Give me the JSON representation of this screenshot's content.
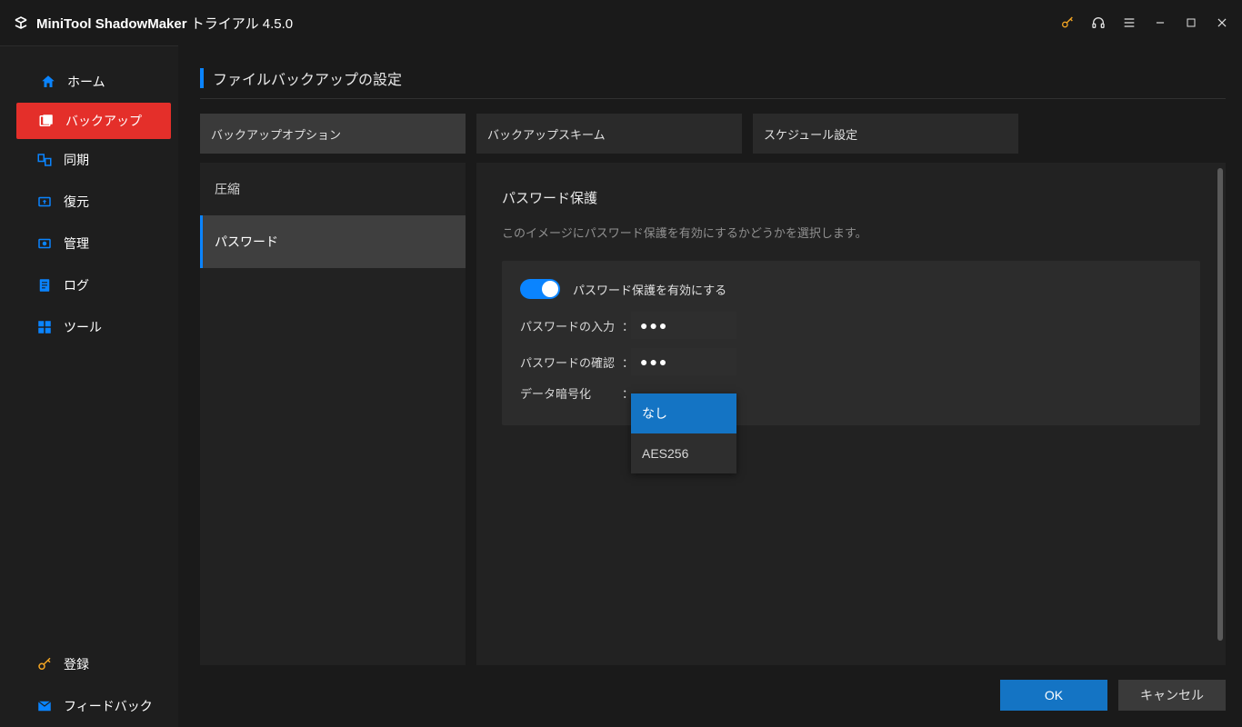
{
  "titlebar": {
    "app_name": "MiniTool ShadowMaker",
    "edition": "トライアル 4.5.0"
  },
  "sidebar": {
    "items": [
      {
        "label": "ホーム",
        "icon": "home"
      },
      {
        "label": "バックアップ",
        "icon": "backup"
      },
      {
        "label": "同期",
        "icon": "sync"
      },
      {
        "label": "復元",
        "icon": "restore"
      },
      {
        "label": "管理",
        "icon": "manage"
      },
      {
        "label": "ログ",
        "icon": "log"
      },
      {
        "label": "ツール",
        "icon": "tools"
      }
    ],
    "bottom": [
      {
        "label": "登録",
        "icon": "key"
      },
      {
        "label": "フィードバック",
        "icon": "feedback"
      }
    ]
  },
  "page": {
    "title": "ファイルバックアップの設定",
    "tabs": [
      {
        "label": "バックアップオプション"
      },
      {
        "label": "バックアップスキーム"
      },
      {
        "label": "スケジュール設定"
      }
    ],
    "options": [
      {
        "label": "圧縮"
      },
      {
        "label": "パスワード"
      }
    ],
    "panel": {
      "title": "パスワード保護",
      "desc": "このイメージにパスワード保護を有効にするかどうかを選択します。",
      "toggle_label": "パスワード保護を有効にする",
      "toggle_on": true,
      "password_label": "パスワードの入力",
      "password_value": "●●●",
      "confirm_label": "パスワードの確認",
      "confirm_value": "●●●",
      "encrypt_label": "データ暗号化",
      "encrypt_options": [
        "なし",
        "AES256"
      ],
      "encrypt_selected": "なし"
    },
    "footer": {
      "ok": "OK",
      "cancel": "キャンセル"
    }
  }
}
